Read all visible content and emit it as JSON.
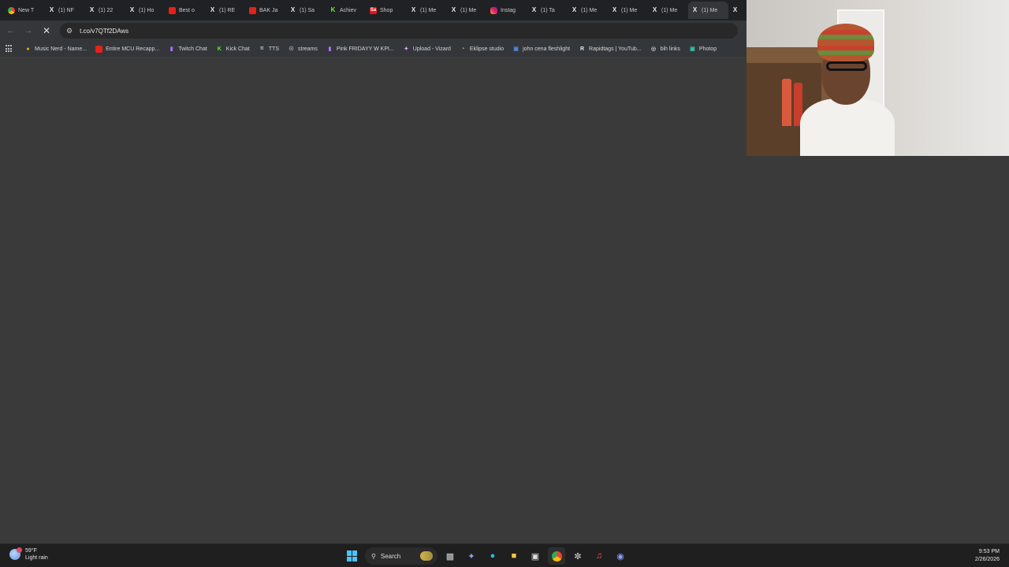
{
  "browser": {
    "tabs": [
      {
        "label": "New T",
        "icon": "chrome-icon",
        "kind": "chrome"
      },
      {
        "label": "(1) NF",
        "icon": "x-icon",
        "kind": "x"
      },
      {
        "label": "(1) 22",
        "icon": "x-icon",
        "kind": "x"
      },
      {
        "label": "(1) Ho",
        "icon": "x-icon",
        "kind": "x"
      },
      {
        "label": "Best o",
        "icon": "youtube-icon",
        "kind": "yt"
      },
      {
        "label": "(1) RE",
        "icon": "x-icon",
        "kind": "x"
      },
      {
        "label": "BAK Ja",
        "icon": "youtube-icon",
        "kind": "yt"
      },
      {
        "label": "(1) Sa",
        "icon": "x-icon",
        "kind": "x"
      },
      {
        "label": "Achiev",
        "icon": "kick-icon",
        "kind": "kick"
      },
      {
        "label": "Shop",
        "icon": "shop-icon",
        "kind": "shop"
      },
      {
        "label": "(1) Me",
        "icon": "x-icon",
        "kind": "x"
      },
      {
        "label": "(1) Me",
        "icon": "x-icon",
        "kind": "x"
      },
      {
        "label": "Instag",
        "icon": "instagram-icon",
        "kind": "insta"
      },
      {
        "label": "(1) Ta",
        "icon": "x-icon",
        "kind": "x"
      },
      {
        "label": "(1) Me",
        "icon": "x-icon",
        "kind": "x"
      },
      {
        "label": "(1) Me",
        "icon": "x-icon",
        "kind": "x"
      },
      {
        "label": "(1) Me",
        "icon": "x-icon",
        "kind": "x"
      },
      {
        "label": "(1) Me",
        "icon": "x-icon",
        "kind": "x",
        "active": true
      },
      {
        "label": "",
        "icon": "x-icon",
        "kind": "x"
      }
    ],
    "url": "t.co/v7QTf2DAws",
    "bookmarks": [
      {
        "label": "Music Nerd - Name...",
        "icon": "music-icon",
        "kind": "music"
      },
      {
        "label": "Entire MCU Recapp...",
        "icon": "youtube-icon",
        "kind": "yt"
      },
      {
        "label": "Twitch Chat",
        "icon": "twitch-icon",
        "kind": "twitch"
      },
      {
        "label": "Kick Chat",
        "icon": "kick-icon",
        "kind": "kick"
      },
      {
        "label": "TTS",
        "icon": "tts-icon",
        "kind": "tts"
      },
      {
        "label": "streams",
        "icon": "streams-icon",
        "kind": "streams"
      },
      {
        "label": "Pink FRIDAYY W KPI...",
        "icon": "twitch-icon",
        "kind": "pink"
      },
      {
        "label": "Upload - Vizard",
        "icon": "vizard-icon",
        "kind": "vizard"
      },
      {
        "label": "Eklipse studio",
        "icon": "eklipse-icon",
        "kind": "eklipse"
      },
      {
        "label": "john cena fleshlight",
        "icon": "image-icon",
        "kind": "fleshlight"
      },
      {
        "label": "Rapidtags | YouTub...",
        "icon": "rapidtags-icon",
        "kind": "rapid"
      },
      {
        "label": "bih links",
        "icon": "globe-icon",
        "kind": "globe"
      },
      {
        "label": "Photop",
        "icon": "photopea-icon",
        "kind": "photop"
      }
    ]
  },
  "taskbar": {
    "weather_temp": "59°F",
    "weather_desc": "Light rain",
    "search_label": "Search",
    "time": "9:53 PM",
    "date": "2/26/2026"
  }
}
